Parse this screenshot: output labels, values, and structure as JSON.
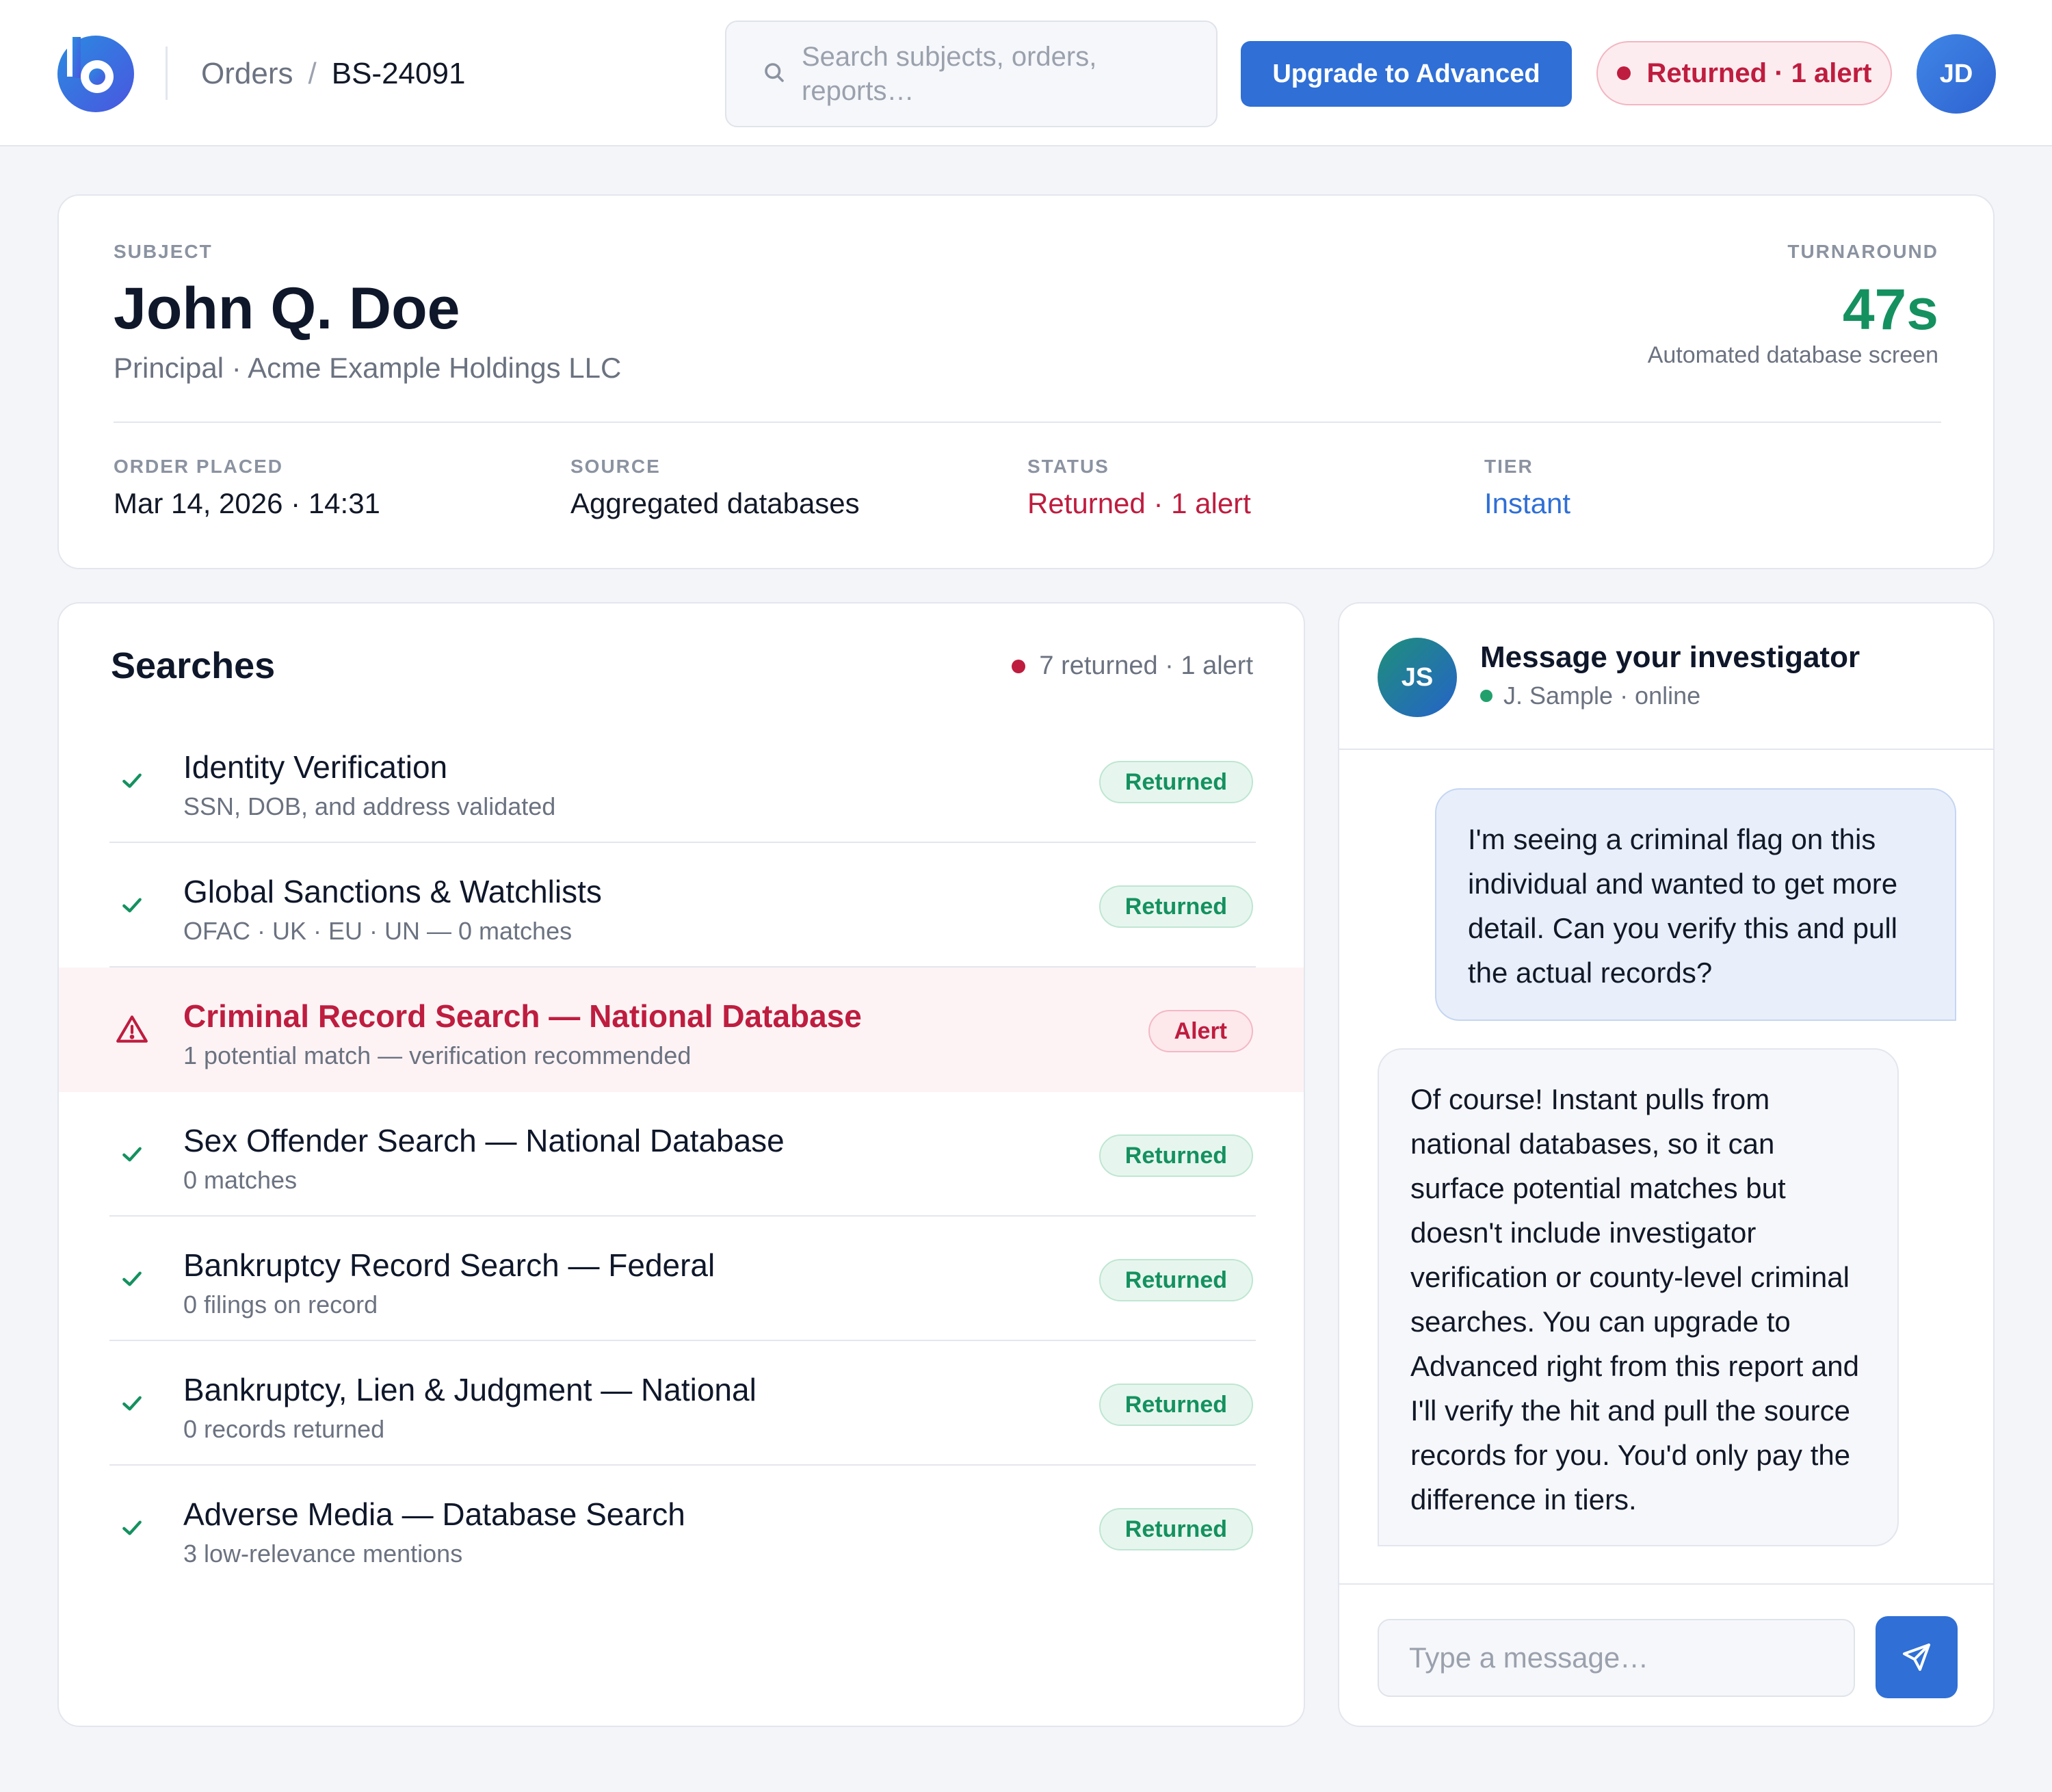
{
  "header": {
    "breadcrumb_parent": "Orders",
    "breadcrumb_separator": "/",
    "breadcrumb_current": "BS-24091",
    "search_placeholder": "Search subjects, orders, reports…",
    "upgrade_label": "Upgrade to Advanced",
    "status_pill": "Returned · 1 alert",
    "user_initials": "JD",
    "logo_icon": "brand-logo-icon"
  },
  "subject": {
    "label": "SUBJECT",
    "name": "John Q. Doe",
    "role": "Principal · Acme Example Holdings LLC",
    "turnaround_label": "TURNAROUND",
    "turnaround_value": "47s",
    "turnaround_desc": "Automated database screen",
    "meta": {
      "order_placed_label": "ORDER PLACED",
      "order_placed_value": "Mar 14, 2026 · 14:31",
      "source_label": "SOURCE",
      "source_value": "Aggregated databases",
      "status_label": "STATUS",
      "status_value": "Returned · 1 alert",
      "tier_label": "TIER",
      "tier_value": "Instant"
    }
  },
  "searches": {
    "title": "Searches",
    "summary": "7 returned · 1 alert",
    "items": [
      {
        "title": "Identity Verification",
        "detail": "SSN, DOB, and address validated",
        "status": "Returned",
        "icon": "check-icon"
      },
      {
        "title": "Global Sanctions & Watchlists",
        "detail": "OFAC · UK · EU · UN — 0 matches",
        "status": "Returned",
        "icon": "check-icon"
      },
      {
        "title": "Criminal Record Search — National Database",
        "detail": "1 potential match — verification recommended",
        "status": "Alert",
        "icon": "warning-icon"
      },
      {
        "title": "Sex Offender Search — National Database",
        "detail": "0 matches",
        "status": "Returned",
        "icon": "check-icon"
      },
      {
        "title": "Bankruptcy Record Search — Federal",
        "detail": "0 filings on record",
        "status": "Returned",
        "icon": "check-icon"
      },
      {
        "title": "Bankruptcy, Lien & Judgment — National",
        "detail": "0 records returned",
        "status": "Returned",
        "icon": "check-icon"
      },
      {
        "title": "Adverse Media — Database Search",
        "detail": "3 low-relevance mentions",
        "status": "Returned",
        "icon": "check-icon"
      }
    ]
  },
  "chat": {
    "title": "Message your investigator",
    "investigator_initials": "JS",
    "investigator_status": "J. Sample · online",
    "messages": [
      {
        "from": "user",
        "text": "I'm seeing a criminal flag on this individual and wanted to get more detail. Can you verify this and pull the actual records?"
      },
      {
        "from": "investigator",
        "text": "Of course! Instant pulls from national databases, so it can surface potential matches but doesn't include investigator verification or county-level criminal searches. You can upgrade to Advanced right from this report and I'll verify the hit and pull the source records for you. You'd only pay the difference in tiers."
      }
    ],
    "input_placeholder": "Type a message…",
    "send_icon": "send-icon"
  },
  "colors": {
    "accent": "#2f6fd6",
    "alert": "#be1d3f",
    "success": "#14915f",
    "background": "#f4f5f9"
  }
}
